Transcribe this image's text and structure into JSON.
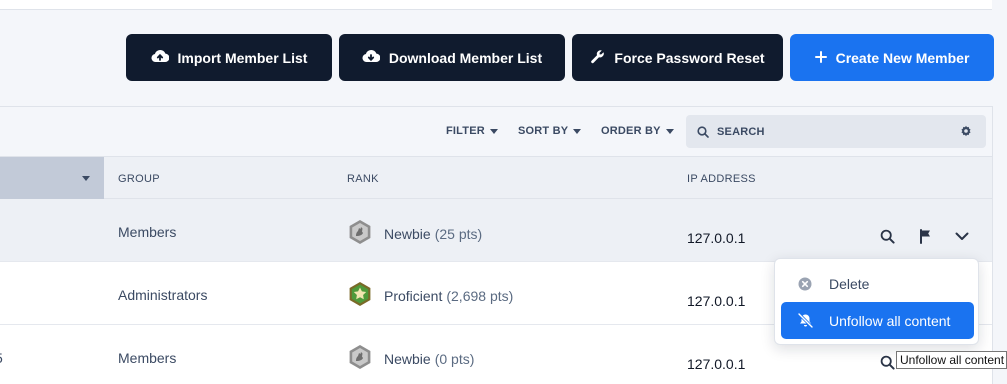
{
  "header": {
    "buttons": [
      {
        "label": "Import Member List",
        "icon": "cloud-upload-icon"
      },
      {
        "label": "Download Member List",
        "icon": "cloud-download-icon"
      },
      {
        "label": "Force Password Reset",
        "icon": "wrench-icon"
      },
      {
        "label": "Create New Member",
        "icon": "plus-icon"
      }
    ]
  },
  "toolbar": {
    "filter_label": "FILTER",
    "sort_by_label": "SORT BY",
    "order_by_label": "ORDER BY",
    "search_placeholder": "SEARCH"
  },
  "table": {
    "columns": {
      "group": "GROUP",
      "rank": "RANK",
      "ip": "IP ADDRESS"
    },
    "rows": [
      {
        "name_partial": "",
        "group": "Members",
        "rank": "Newbie",
        "points": "(25 pts)",
        "rank_badge": "gray",
        "ip": "127.0.0.1"
      },
      {
        "name_partial": "",
        "group": "Administrators",
        "rank": "Proficient",
        "points": "(2,698 pts)",
        "rank_badge": "green-star",
        "ip": "127.0.0.1"
      },
      {
        "name_partial": "5",
        "group": "Members",
        "rank": "Newbie",
        "points": "(0 pts)",
        "rank_badge": "gray",
        "ip": "127.0.0.1"
      }
    ]
  },
  "dropdown": {
    "items": [
      {
        "label": "Delete",
        "icon": "close-circle-icon"
      },
      {
        "label": "Unfollow all content",
        "icon": "bell-off-icon",
        "active": true
      }
    ]
  },
  "tooltip": {
    "text": "Unfollow all content"
  },
  "colors": {
    "dark_button": "#101b2e",
    "primary": "#1a73f0",
    "sorted_header": "#c2cad8",
    "row_highlight": "#edf0f5"
  }
}
